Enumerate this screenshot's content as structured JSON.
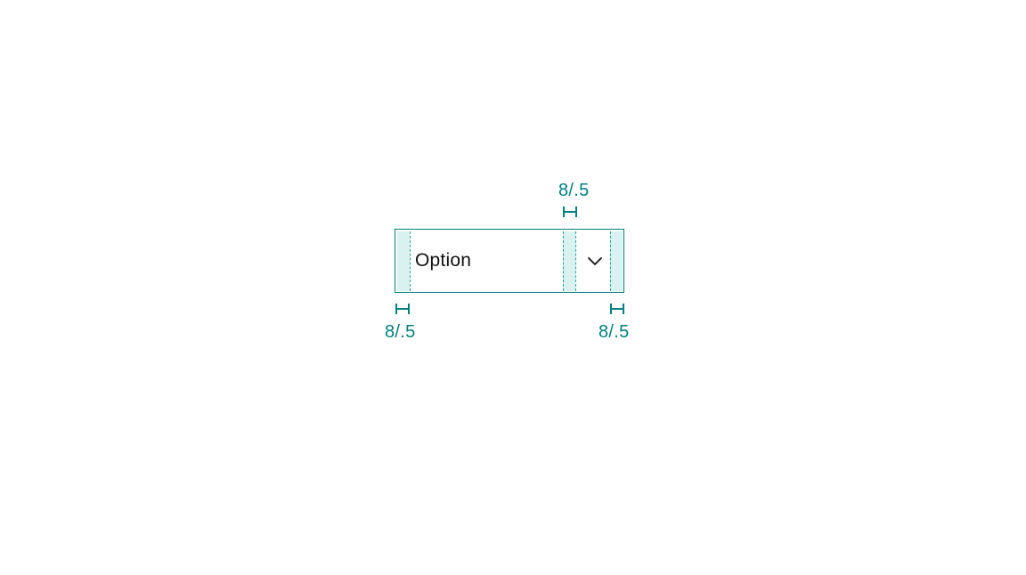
{
  "diagram": {
    "dropdown_label": "Option",
    "annotations": {
      "top_gap": "8/.5",
      "bottom_left": "8/.5",
      "bottom_right": "8/.5"
    },
    "spacing_value_px": 8,
    "spacing_value_rem": 0.5,
    "colors": {
      "teal": "#008080",
      "teal_light": "#d9f2ef",
      "text": "#111111"
    }
  }
}
